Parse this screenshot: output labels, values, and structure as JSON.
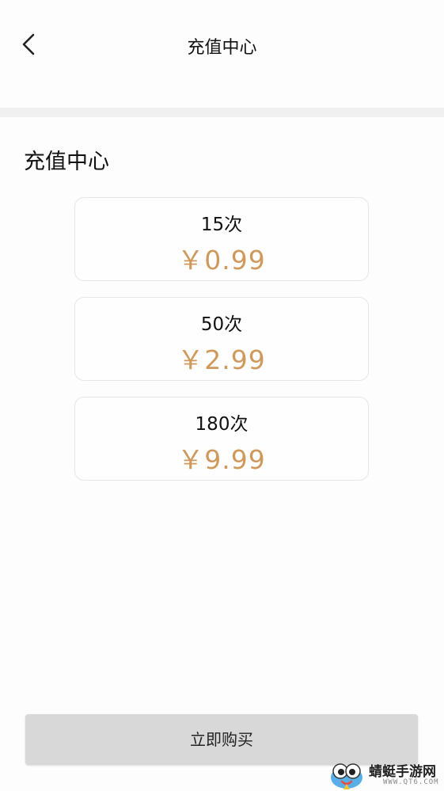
{
  "header": {
    "title": "充值中心"
  },
  "section": {
    "title": "充值中心"
  },
  "packages": [
    {
      "count": "15次",
      "price": "￥0.99"
    },
    {
      "count": "50次",
      "price": "￥2.99"
    },
    {
      "count": "180次",
      "price": "￥9.99"
    }
  ],
  "buy_button": {
    "label": "立即购买"
  },
  "watermark": {
    "text": "蜻蜓手游网",
    "url": "WWW.QT6.COM"
  },
  "colors": {
    "price": "#d0995c",
    "button_bg": "#d8d8d8",
    "divider": "#f0f0f0"
  },
  "icons": {
    "back": "chevron-left-icon"
  }
}
